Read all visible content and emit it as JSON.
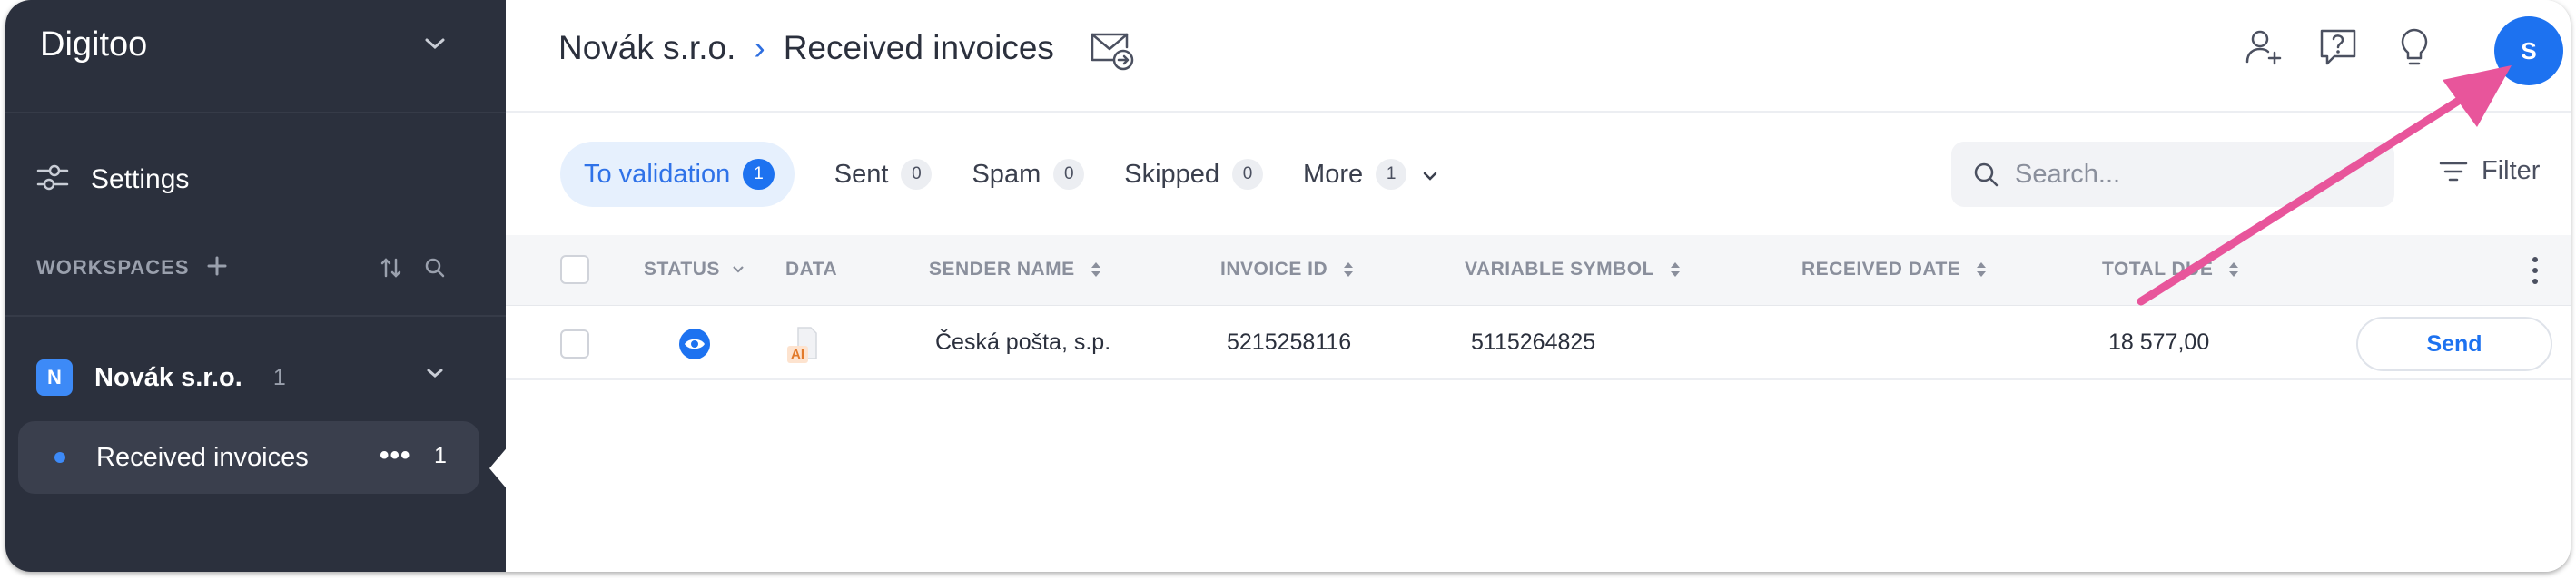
{
  "sidebar": {
    "brand": "Digitoo",
    "settings_label": "Settings",
    "workspaces_label": "WORKSPACES",
    "company": {
      "badge": "N",
      "name": "Novák s.r.o.",
      "count": "1"
    },
    "active_item": {
      "label": "Received invoices",
      "more": "•••",
      "count": "1"
    }
  },
  "header": {
    "breadcrumb_company": "Novák s.r.o.",
    "breadcrumb_separator": "›",
    "breadcrumb_page": "Received invoices",
    "avatar_initial": "S"
  },
  "tabs": [
    {
      "label": "To validation",
      "count": "1",
      "active": true
    },
    {
      "label": "Sent",
      "count": "0"
    },
    {
      "label": "Spam",
      "count": "0"
    },
    {
      "label": "Skipped",
      "count": "0"
    },
    {
      "label": "More",
      "count": "1"
    }
  ],
  "search": {
    "placeholder": "Search..."
  },
  "filter_label": "Filter",
  "table": {
    "columns": [
      "STATUS",
      "DATA",
      "SENDER NAME",
      "INVOICE ID",
      "VARIABLE SYMBOL",
      "RECEIVED DATE",
      "TOTAL DUE"
    ],
    "rows": [
      {
        "sender_name": "Česká pošta, s.p.",
        "data_badge": "AI",
        "invoice_id": "5215258116",
        "variable_symbol": "5115264825",
        "received_date": "",
        "total_due": "18 577,00",
        "action": "Send"
      }
    ]
  },
  "colors": {
    "sidebar_bg": "#2b303d",
    "accent": "#1d72f0",
    "annotation_arrow": "#e8559b"
  },
  "icons": [
    "chevron-down-icon",
    "settings-sliders-icon",
    "plus-icon",
    "sort-icon",
    "search-icon",
    "mail-forward-icon",
    "add-user-icon",
    "help-icon",
    "lightbulb-icon",
    "eye-icon",
    "document-icon",
    "filter-icon",
    "kebab-icon",
    "annotation-arrow"
  ]
}
